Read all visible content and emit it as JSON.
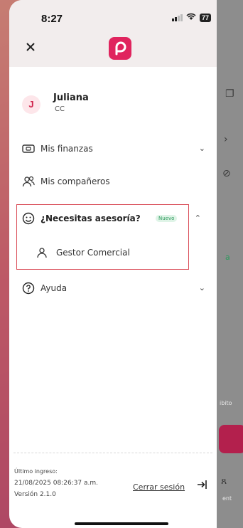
{
  "status_bar": {
    "time": "8:27",
    "battery": "77"
  },
  "user": {
    "initial": "J",
    "name": "Juliana",
    "subtitle": "CC"
  },
  "menu": [
    {
      "label": "Mis finanzas",
      "icon": "wallet-icon",
      "expanded": false
    },
    {
      "label": "Mis compañeros",
      "icon": "people-icon"
    },
    {
      "label": "¿Necesitas asesoría?",
      "icon": "smiley-icon",
      "badge": "Nuevo",
      "expanded": true,
      "children": [
        {
          "label": "Gestor Comercial",
          "icon": "person-icon"
        }
      ]
    },
    {
      "label": "Ayuda",
      "icon": "help-circle-icon",
      "expanded": false
    }
  ],
  "footer": {
    "last_login_label": "Último ingreso:",
    "last_login_value": "21/08/2025 08:26:37 a.m.",
    "version": "Versión 2.1.0",
    "logout_label": "Cerrar sesión"
  },
  "background_app": {
    "text_a": "ibito",
    "text_b": "ent",
    "text_c": "a"
  },
  "colors": {
    "brand": "#e0245e",
    "highlight_border": "#d94a55",
    "badge_green": "#2c9a5c"
  }
}
